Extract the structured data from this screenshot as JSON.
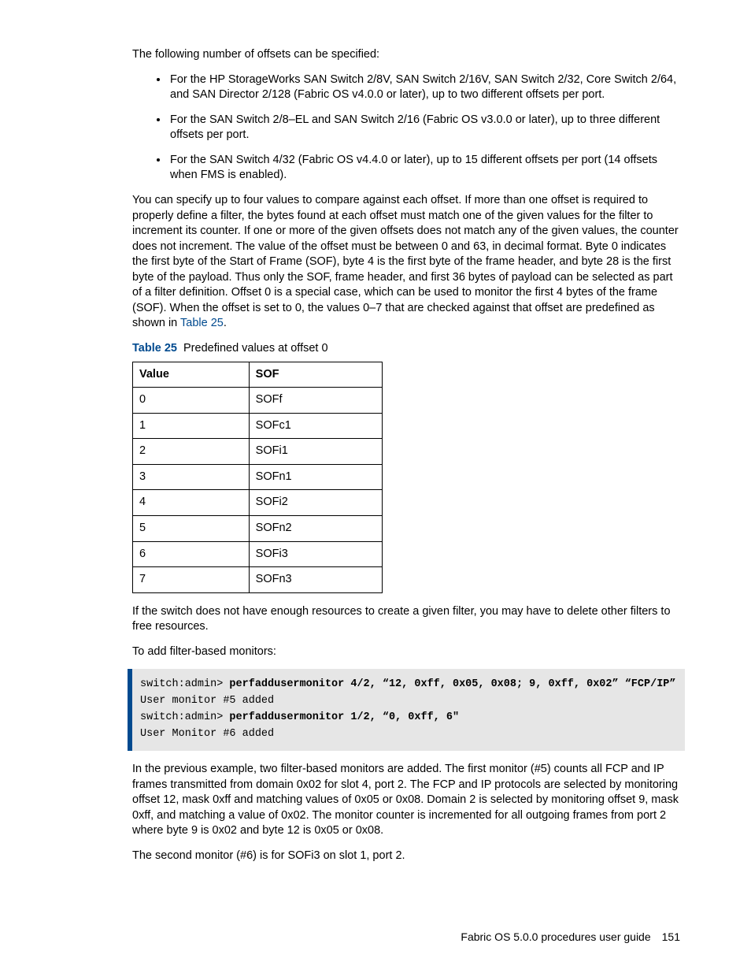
{
  "intro": "The following number of offsets can be specified:",
  "bullets": [
    "For the HP StorageWorks SAN Switch 2/8V, SAN Switch 2/16V, SAN Switch 2/32, Core Switch 2/64, and SAN Director 2/128 (Fabric OS v4.0.0 or later), up to two different offsets per port.",
    "For the SAN Switch 2/8–EL and SAN Switch 2/16 (Fabric OS v3.0.0 or later), up to three different offsets per port.",
    "For the SAN Switch 4/32 (Fabric OS v4.4.0 or later), up to 15 different offsets per port (14 offsets when FMS is enabled)."
  ],
  "para2_a": "You can specify up to four values to compare against each offset. If more than one offset is required to properly define a filter, the bytes found at each offset must match one of the given values for the filter to increment its counter. If one or more of the given offsets does not match any of the given values, the counter does not increment. The value of the offset must be between 0 and 63, in decimal format. Byte 0 indicates the first byte of the Start of Frame (SOF), byte 4 is the first byte of the frame header, and byte 28 is the first byte of the payload. Thus only the SOF, frame header, and first 36 bytes of payload can be selected as part of a filter definition. Offset 0 is a special case, which can be used to monitor the first 4 bytes of the frame (SOF). When the offset is set to 0, the values 0–7 that are checked against that offset are predefined as shown in ",
  "para2_link": "Table 25",
  "para2_b": ".",
  "table25": {
    "caption_num": "Table 25",
    "caption_txt": "Predefined values at offset 0",
    "head_c1": "Value",
    "head_c2": "SOF",
    "rows": [
      {
        "v": "0",
        "s": "SOFf"
      },
      {
        "v": "1",
        "s": "SOFc1"
      },
      {
        "v": "2",
        "s": "SOFi1"
      },
      {
        "v": "3",
        "s": "SOFn1"
      },
      {
        "v": "4",
        "s": "SOFi2"
      },
      {
        "v": "5",
        "s": "SOFn2"
      },
      {
        "v": "6",
        "s": "SOFi3"
      },
      {
        "v": "7",
        "s": "SOFn3"
      }
    ]
  },
  "para3": "If the switch does not have enough resources to create a given filter, you may have to delete other filters to free resources.",
  "para4": "To add filter-based monitors:",
  "code": {
    "l1a": "switch:admin> ",
    "l1b": "perfaddusermonitor 4/2, “12, 0xff, 0x05, 0x08; 9, 0xff, 0x02” “FCP/IP”",
    "l2": "User monitor #5 added",
    "l3a": "switch:admin> ",
    "l3b": "perfaddusermonitor 1/2, “0, 0xff, 6\"",
    "l4": "User Monitor #6 added"
  },
  "para5": "In the previous example, two filter-based monitors are added. The first monitor (#5) counts all FCP and IP frames transmitted from domain 0x02 for slot 4, port 2. The FCP and IP protocols are selected by monitoring offset 12, mask 0xff and matching values of 0x05 or 0x08. Domain 2 is selected by monitoring offset 9, mask 0xff, and matching a value of 0x02. The monitor counter is incremented for all outgoing frames from port 2 where byte 9 is 0x02 and byte 12 is 0x05 or 0x08.",
  "para6": "The second monitor (#6) is for SOFi3 on slot 1, port 2.",
  "footer": "Fabric OS 5.0.0 procedures user guide 151"
}
